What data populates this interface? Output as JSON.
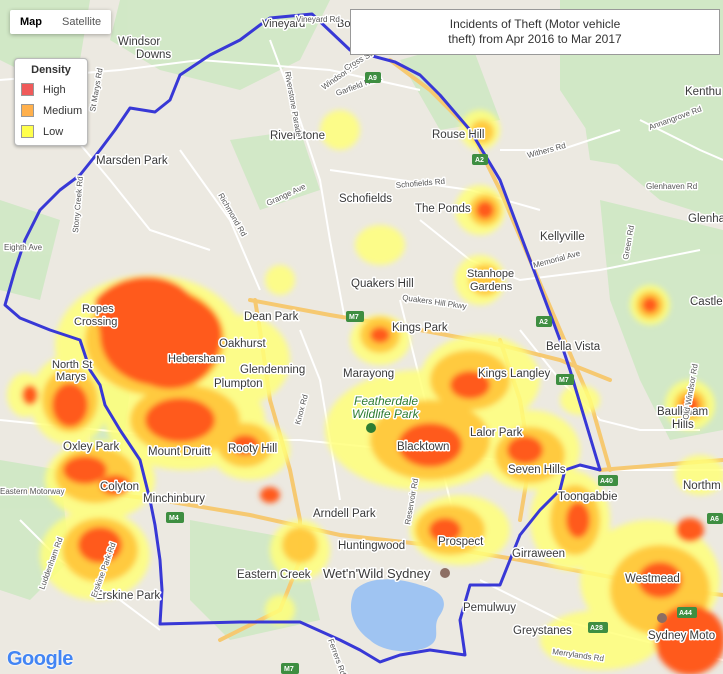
{
  "map_type": {
    "map_label": "Map",
    "satellite_label": "Satellite"
  },
  "title": "Incidents of Theft (Motor vehicle theft) from Apr 2016 to Mar 2017",
  "title_lines": [
    "Incidents of Theft (Motor vehicle",
    "theft) from Apr 2016 to Mar 2017"
  ],
  "legend": {
    "title": "Density",
    "items": [
      {
        "label": "High",
        "color": "#f05a5a"
      },
      {
        "label": "Medium",
        "color": "#ffb04c"
      },
      {
        "label": "Low",
        "color": "#ffff4c"
      }
    ]
  },
  "colors": {
    "boundary": "#3838d6",
    "heat_high": "#ff5a1e",
    "heat_medium": "#ffc83a",
    "heat_low": "#ffff7a",
    "water": "#9fc4f2",
    "park": "#c9e7bf",
    "motorway": "#f6c971"
  },
  "place_labels": [
    "Vineyard",
    "Bo",
    "Windsor",
    "Downs",
    "Riverstone",
    "Marsden Park",
    "Rouse Hill",
    "Schofields",
    "The Ponds",
    "Kellyville",
    "Stanhope",
    "Gardens",
    "Quakers Hill",
    "Kings Park",
    "Dean Park",
    "Ropes",
    "Crossing",
    "Oakhurst",
    "Hebersham",
    "Glendenning",
    "Plumpton",
    "North St",
    "Marys",
    "Marayong",
    "Kings Langley",
    "Bella Vista",
    "Featherdale",
    "Wildlife Park",
    "Oxley Park",
    "Mount Druitt",
    "Rooty Hill",
    "Blacktown",
    "Lalor Park",
    "Seven Hills",
    "Colyton",
    "Minchinbury",
    "Arndell Park",
    "Prospect",
    "Huntingwood",
    "Girraween",
    "Eastern Creek",
    "Wet'n'Wild Sydney",
    "Erskine Park",
    "Pemulwuy",
    "Greystanes",
    "Toongabbie",
    "Westmead",
    "Sydney Moto",
    "Castle",
    "Baulkham",
    "Hills",
    "Northm",
    "Kenthu",
    "Glenhav"
  ],
  "road_labels": [
    "Eastern Motorway",
    "Windsor Rd",
    "Schofields Rd",
    "Richmond Rd",
    "Quakers Hill Pkwy",
    "Knox Rd",
    "Reservoir Rd",
    "Old Windsor Rd",
    "Memorial Ave",
    "Garfield Rd E",
    "Grange Ave",
    "Luddenham Rd",
    "Erskine Park Rd",
    "Merrylands Rd",
    "Annangrove Rd",
    "Green Rd",
    "Withers Rd",
    "Glenhaven Rd",
    "Ferrers Rd",
    "Stony Creek Rd",
    "Vineyard Rd",
    "Riverstone Parade",
    "Cross St",
    "St Marys Rd",
    "Eighth Ave"
  ],
  "road_shields": [
    "M7",
    "M4",
    "A2",
    "A28",
    "A40",
    "A44",
    "A9",
    "A6"
  ],
  "google_logo": "Google"
}
